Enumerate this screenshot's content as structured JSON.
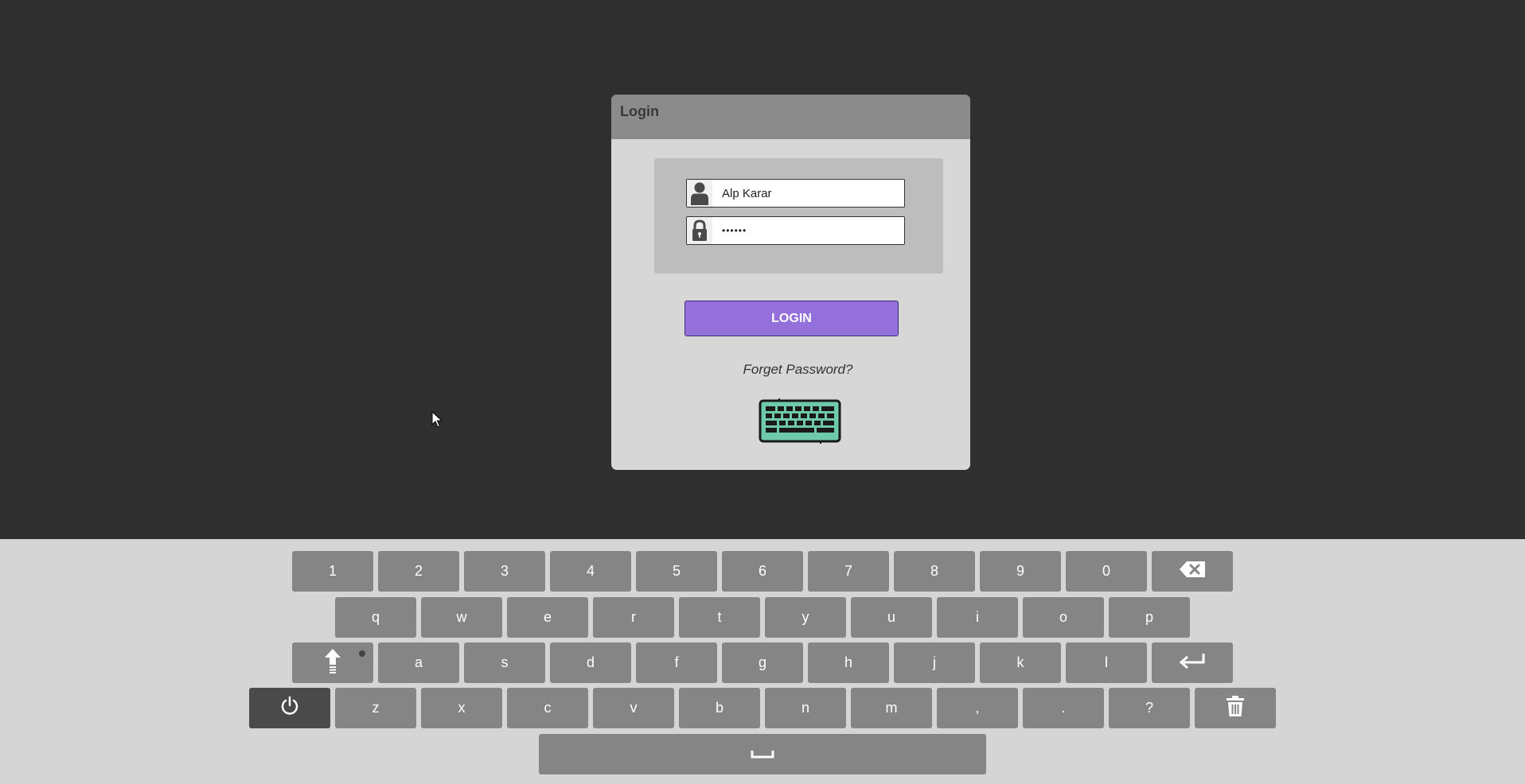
{
  "dialog": {
    "title": "Login",
    "username_value": "Alp Karar",
    "password_value": "••••••",
    "login_label": "LOGIN",
    "forget_label": "Forget Password?"
  },
  "colors": {
    "background": "#2f2f2f",
    "dialog": "#d7d7d7",
    "header": "#8b8b8b",
    "accent": "#9370db",
    "keyboard_icon": "#6fcaa9",
    "key": "#858585"
  },
  "icons": {
    "username": "user-icon",
    "password": "lock-icon",
    "keyboard_toggle": "keyboard-icon",
    "backspace": "backspace-icon",
    "caps": "shift-arrow-icon",
    "enter": "enter-arrow-icon",
    "power": "power-icon",
    "trash": "trash-icon",
    "space": "space-icon"
  },
  "keyboard": {
    "row1": [
      "1",
      "2",
      "3",
      "4",
      "5",
      "6",
      "7",
      "8",
      "9",
      "0"
    ],
    "row2": [
      "q",
      "w",
      "e",
      "r",
      "t",
      "y",
      "u",
      "i",
      "o",
      "p"
    ],
    "row3": [
      "a",
      "s",
      "d",
      "f",
      "g",
      "h",
      "j",
      "k",
      "l"
    ],
    "row4": [
      "z",
      "x",
      "c",
      "v",
      "b",
      "n",
      "m",
      ",",
      ".",
      "?"
    ]
  }
}
